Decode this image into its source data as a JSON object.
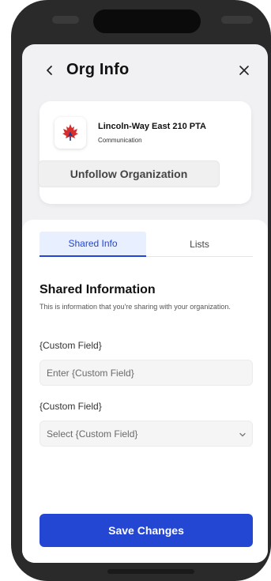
{
  "header": {
    "title": "Org Info",
    "back_icon": "chevron-left-icon",
    "close_icon": "close-icon"
  },
  "org": {
    "name": "Lincoln-Way East 210 PTA",
    "category": "Communication",
    "logo_icon": "maple-leaf-logo",
    "unfollow_label": "Unfollow Organization"
  },
  "tabs": [
    {
      "label": "Shared Info",
      "active": true
    },
    {
      "label": "Lists",
      "active": false
    }
  ],
  "shared": {
    "title": "Shared Information",
    "description": "This is information that you're sharing with your organization.",
    "fields": [
      {
        "label": "{Custom Field}",
        "type": "text",
        "placeholder": "Enter {Custom Field}"
      },
      {
        "label": "{Custom Field}",
        "type": "select",
        "value": "Select {Custom Field}"
      }
    ]
  },
  "save_label": "Save Changes",
  "colors": {
    "accent": "#2346d3",
    "tab_active_bg": "#e8efff",
    "logo_red": "#d62d2d",
    "logo_navy": "#1f3a93"
  }
}
